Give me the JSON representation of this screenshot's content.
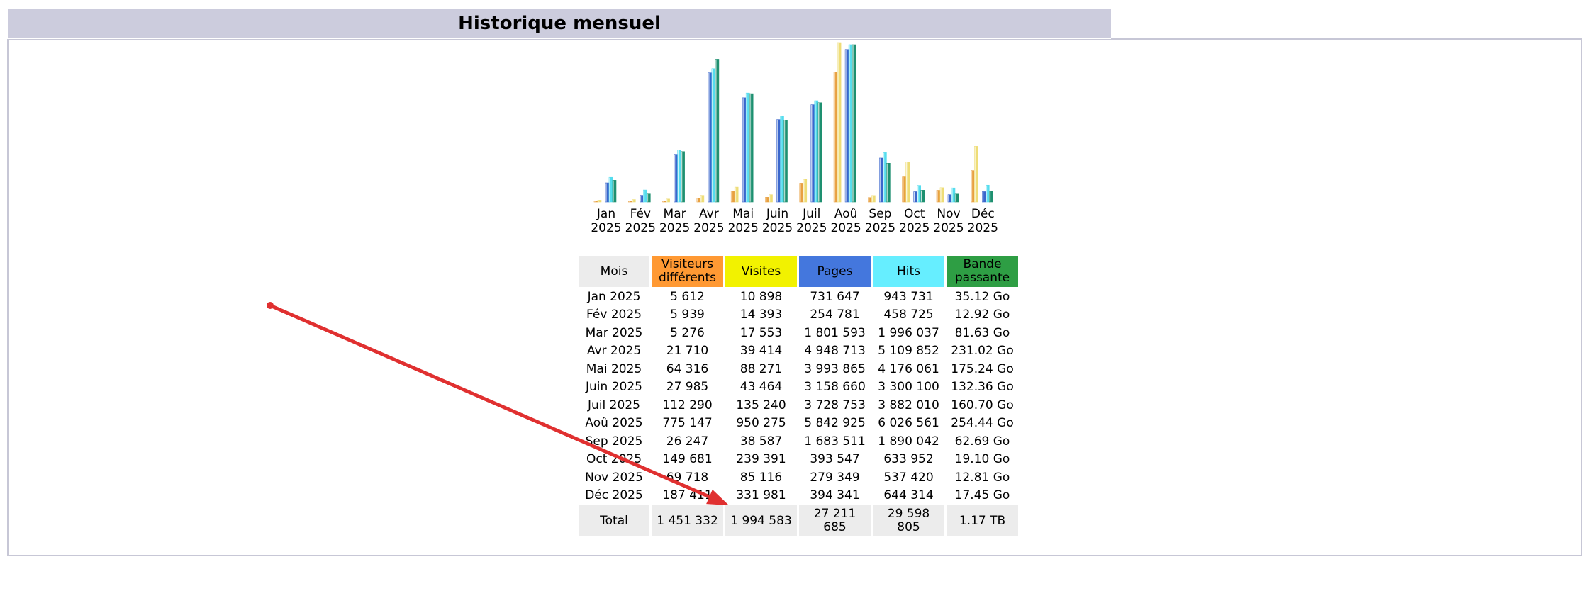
{
  "header": {
    "title": "Historique mensuel"
  },
  "colors": {
    "visitors": "#e8a040",
    "visits": "#eedd77",
    "pages": "#3a66cc",
    "hits": "#55ddee",
    "bandwidth": "#1e9070",
    "annotation_arrow": "#e03030"
  },
  "chart_data": {
    "type": "bar",
    "categories": [
      "Jan 2025",
      "Fév 2025",
      "Mar 2025",
      "Avr 2025",
      "Mai 2025",
      "Juin 2025",
      "Juil 2025",
      "Aoû 2025",
      "Sep 2025",
      "Oct 2025",
      "Nov 2025",
      "Déc 2025"
    ],
    "category_labels": [
      [
        "Jan",
        "2025"
      ],
      [
        "Fév",
        "2025"
      ],
      [
        "Mar",
        "2025"
      ],
      [
        "Avr",
        "2025"
      ],
      [
        "Mai",
        "2025"
      ],
      [
        "Juin",
        "2025"
      ],
      [
        "Juil",
        "2025"
      ],
      [
        "Aoû",
        "2025"
      ],
      [
        "Sep",
        "2025"
      ],
      [
        "Oct",
        "2025"
      ],
      [
        "Nov",
        "2025"
      ],
      [
        "Déc",
        "2025"
      ]
    ],
    "series": [
      {
        "name": "Visiteurs différents",
        "values": [
          5612,
          5939,
          5276,
          21710,
          64316,
          27985,
          112290,
          775147,
          26247,
          149681,
          69718,
          187411
        ]
      },
      {
        "name": "Visites",
        "values": [
          10898,
          14393,
          17553,
          39414,
          88271,
          43464,
          135240,
          950275,
          38587,
          239391,
          85116,
          331981
        ]
      },
      {
        "name": "Pages",
        "values": [
          731647,
          254781,
          1801593,
          4948713,
          3993865,
          3158660,
          3728753,
          5842925,
          1683511,
          393547,
          279349,
          394341
        ]
      },
      {
        "name": "Hits",
        "values": [
          943731,
          458725,
          1996037,
          5109852,
          4176061,
          3300100,
          3882010,
          6026561,
          1890042,
          633952,
          537420,
          644314
        ]
      },
      {
        "name": "Bande passante",
        "values": [
          35.12,
          12.92,
          81.63,
          231.02,
          175.24,
          132.36,
          160.7,
          254.44,
          62.69,
          19.1,
          12.81,
          17.45
        ]
      }
    ]
  },
  "table": {
    "headers": [
      {
        "key": "mois",
        "label": "Mois"
      },
      {
        "key": "vis",
        "label": "Visiteurs différents"
      },
      {
        "key": "visites",
        "label": "Visites"
      },
      {
        "key": "pages",
        "label": "Pages"
      },
      {
        "key": "hits",
        "label": "Hits"
      },
      {
        "key": "bp",
        "label": "Bande passante"
      }
    ],
    "rows": [
      [
        "Jan 2025",
        "5 612",
        "10 898",
        "731 647",
        "943 731",
        "35.12 Go"
      ],
      [
        "Fév 2025",
        "5 939",
        "14 393",
        "254 781",
        "458 725",
        "12.92 Go"
      ],
      [
        "Mar 2025",
        "5 276",
        "17 553",
        "1 801 593",
        "1 996 037",
        "81.63 Go"
      ],
      [
        "Avr 2025",
        "21 710",
        "39 414",
        "4 948 713",
        "5 109 852",
        "231.02 Go"
      ],
      [
        "Mai 2025",
        "64 316",
        "88 271",
        "3 993 865",
        "4 176 061",
        "175.24 Go"
      ],
      [
        "Juin 2025",
        "27 985",
        "43 464",
        "3 158 660",
        "3 300 100",
        "132.36 Go"
      ],
      [
        "Juil 2025",
        "112 290",
        "135 240",
        "3 728 753",
        "3 882 010",
        "160.70 Go"
      ],
      [
        "Aoû 2025",
        "775 147",
        "950 275",
        "5 842 925",
        "6 026 561",
        "254.44 Go"
      ],
      [
        "Sep 2025",
        "26 247",
        "38 587",
        "1 683 511",
        "1 890 042",
        "62.69 Go"
      ],
      [
        "Oct 2025",
        "149 681",
        "239 391",
        "393 547",
        "633 952",
        "19.10 Go"
      ],
      [
        "Nov 2025",
        "69 718",
        "85 116",
        "279 349",
        "537 420",
        "12.81 Go"
      ],
      [
        "Déc 2025",
        "187 411",
        "331 981",
        "394 341",
        "644 314",
        "17.45 Go"
      ]
    ],
    "total": [
      "Total",
      "1 451 332",
      "1 994 583",
      "27 211 685",
      "29 598 805",
      "1.17 TB"
    ]
  }
}
